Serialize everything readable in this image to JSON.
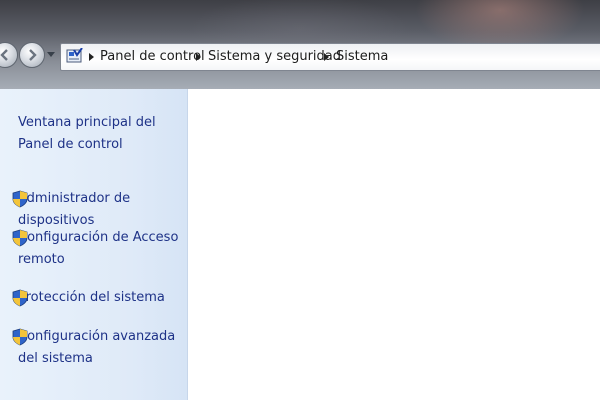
{
  "breadcrumb": {
    "items": [
      "Panel de control",
      "Sistema y seguridad",
      "Sistema"
    ]
  },
  "sidebar": {
    "home_link": "Ventana principal del Panel de control",
    "items": [
      {
        "label": "Administrador de dispositivos",
        "icon": "shield-icon"
      },
      {
        "label": "Configuración de Acceso remoto",
        "icon": "shield-icon"
      },
      {
        "label": "Protección del sistema",
        "icon": "shield-icon"
      },
      {
        "label": "Configuración avanzada del sistema",
        "icon": "shield-icon"
      }
    ]
  },
  "colors": {
    "link": "#1e3287",
    "sidebar_bg": "#dfeaf8"
  }
}
